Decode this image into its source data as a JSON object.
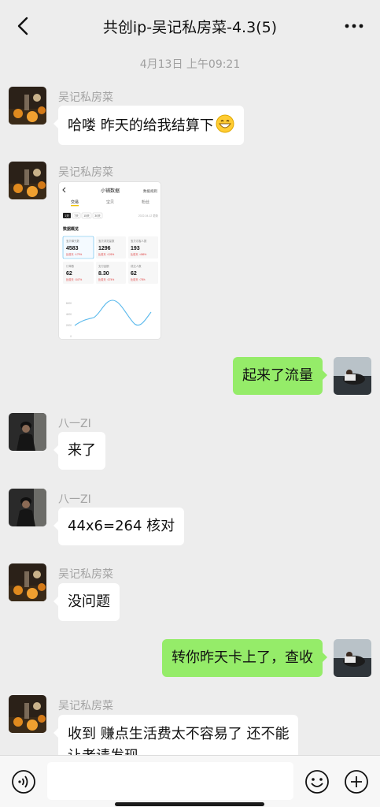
{
  "header": {
    "title": "共创ip-吴记私房菜-4.3(5)"
  },
  "timestamp": "4月13日 上午09:21",
  "messages": [
    {
      "sender": "吴记私房菜",
      "text": "哈喽 昨天的给我结算下",
      "emoji": "grinning-face-emoji"
    },
    {
      "sender": "吴记私房菜",
      "screenshot": {
        "title": "小铺数据",
        "top_right": "数据规则",
        "tabs": [
          "交易",
          "宝贝",
          "粉丝"
        ],
        "ranges": [
          "1天",
          "7天",
          "15天",
          "30天"
        ],
        "date": "2022-04-12 更新",
        "section": "数据概览",
        "metrics": [
          {
            "label": "宝贝曝光数",
            "value": "4583",
            "change": "比前天 ↑179%"
          },
          {
            "label": "宝贝浏览量数",
            "value": "1296",
            "change": "比前天 ↑126%"
          },
          {
            "label": "宝贝访客人数",
            "value": "193",
            "change": "比前天 ↑486%"
          },
          {
            "label": "订单数",
            "value": "62",
            "change": "比前天 ↑347%"
          },
          {
            "label": "支付金额",
            "value": "8.30",
            "change": "比前天 ↑374%"
          },
          {
            "label": "成交人数",
            "value": "62",
            "change": "比前天 ↑78%"
          }
        ],
        "y_ticks": [
          "6000",
          "4000",
          "2000",
          "0"
        ]
      }
    },
    {
      "sender": "me",
      "text": "起来了流量"
    },
    {
      "sender": "八一ZI",
      "text": "来了"
    },
    {
      "sender": "八一ZI",
      "text": "44x6=264  核对"
    },
    {
      "sender": "吴记私房菜",
      "text": "没问题"
    },
    {
      "sender": "me",
      "text": "转你昨天卡上了，查收"
    },
    {
      "sender": "吴记私房菜",
      "text": "收到 赚点生活费太不容易了 还不能",
      "text2": "让老请发现"
    }
  ],
  "colors": {
    "background": "#ededed",
    "bubble_left": "#ffffff",
    "bubble_mine": "#95ec69",
    "chart_line": "#5ab9ec"
  }
}
